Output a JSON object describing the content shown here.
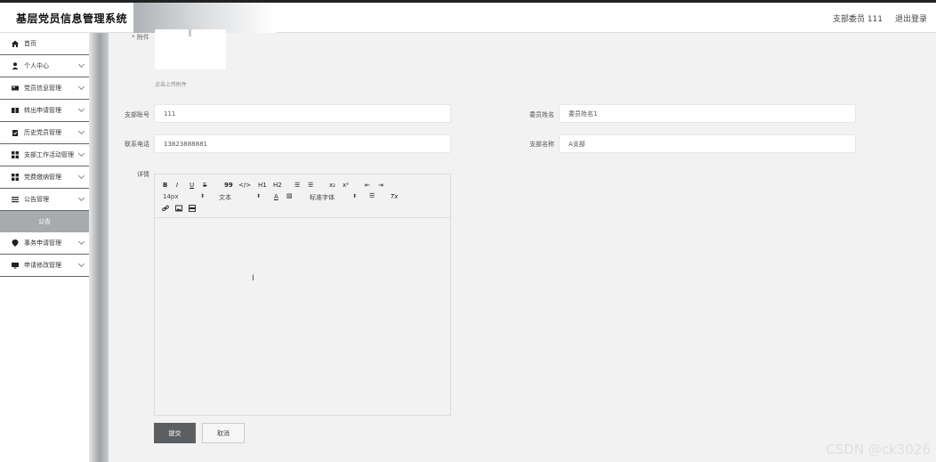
{
  "header": {
    "title": "基层党员信息管理系统",
    "user": "支部委员 111",
    "logout": "退出登录"
  },
  "sidebar": {
    "items": [
      {
        "label": "首页",
        "icon": "home-icon",
        "expandable": false
      },
      {
        "label": "个人中心",
        "icon": "user-icon",
        "expandable": true
      },
      {
        "label": "党员信息管理",
        "icon": "card-icon",
        "expandable": true
      },
      {
        "label": "转出申请管理",
        "icon": "book-icon",
        "expandable": true
      },
      {
        "label": "历史党员管理",
        "icon": "clipboard-icon",
        "expandable": true
      },
      {
        "label": "支部工作活动管理",
        "icon": "grid-icon",
        "expandable": true
      },
      {
        "label": "党费缴纳管理",
        "icon": "grid-icon",
        "expandable": true
      },
      {
        "label": "公告管理",
        "icon": "list-icon",
        "expandable": true
      }
    ],
    "active_sub": "公告",
    "items_after": [
      {
        "label": "事务申请管理",
        "icon": "pin-icon",
        "expandable": true
      },
      {
        "label": "申请修改管理",
        "icon": "monitor-icon",
        "expandable": true
      }
    ]
  },
  "form": {
    "attachment_label": "* 附件",
    "upload_hint": "点击上传附件",
    "branch_account_label": "支部账号",
    "branch_account_value": "111",
    "member_name_label": "委员姓名",
    "member_name_value": "委员姓名1",
    "phone_label": "联系电话",
    "phone_value": "13823888881",
    "branch_name_label": "支部名称",
    "branch_name_value": "A支部",
    "detail_label": "详情"
  },
  "editor": {
    "row1": [
      "B",
      "I",
      "U",
      "S",
      "99",
      "</>",
      "H1",
      "H2",
      "☰",
      "☰",
      "x₂",
      "x²",
      "⇤",
      "⇥"
    ],
    "font_size": "14px",
    "text_style": "文本",
    "font_family": "标准字体",
    "color_btn": "A",
    "clear_format": "Tx"
  },
  "buttons": {
    "submit": "提交",
    "cancel": "取消"
  },
  "watermark": "CSDN @ck3026"
}
